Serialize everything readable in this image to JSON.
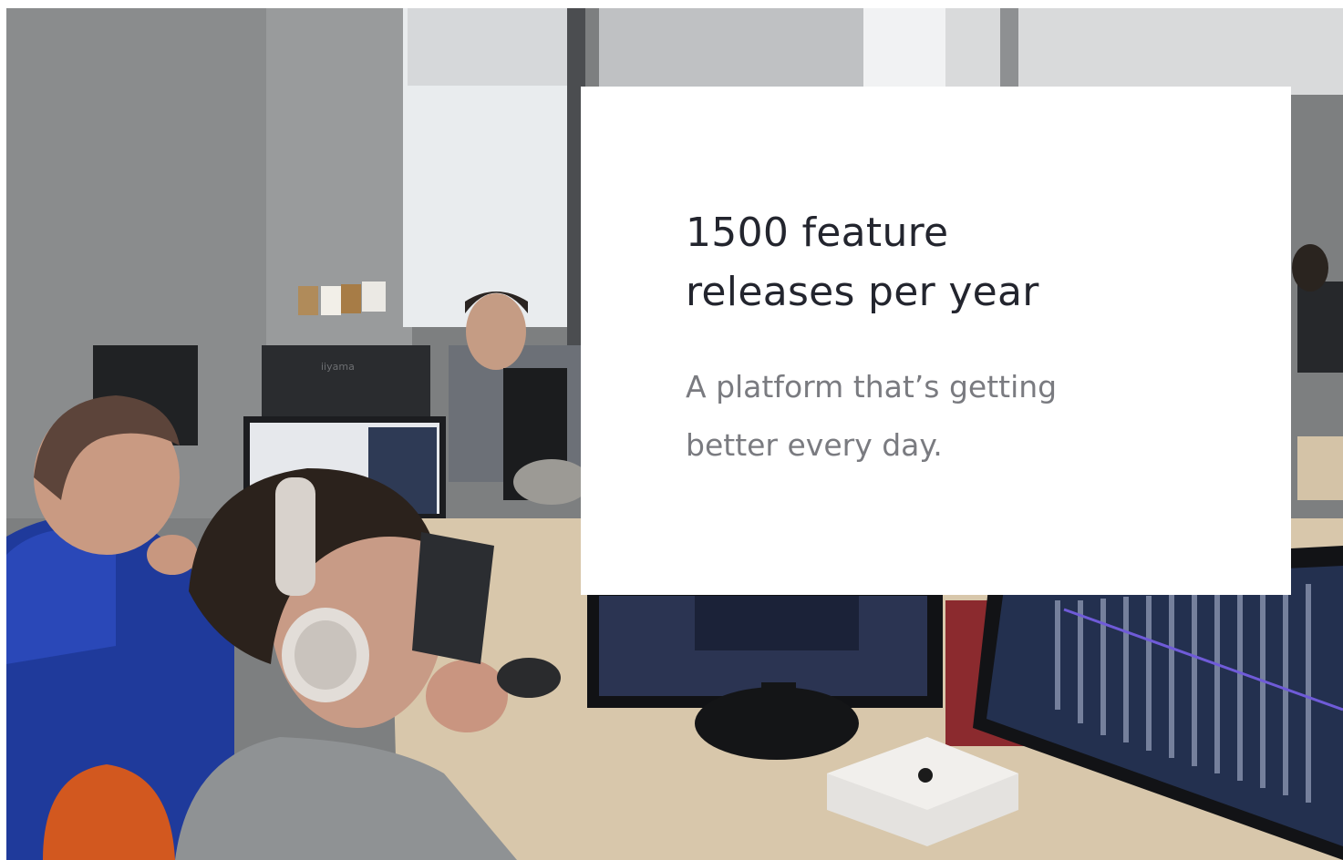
{
  "photo": {
    "description_icon": "office-developers-photo",
    "monitor_brand_text": "iiyama"
  },
  "card": {
    "headline_line1": "1500 feature",
    "headline_line2": "releases per year",
    "subtext_line1": "A platform that’s getting",
    "subtext_line2": "better every day."
  },
  "colors": {
    "headline": "#23252e",
    "subtext": "#7a7b80",
    "card_background": "#ffffff"
  }
}
